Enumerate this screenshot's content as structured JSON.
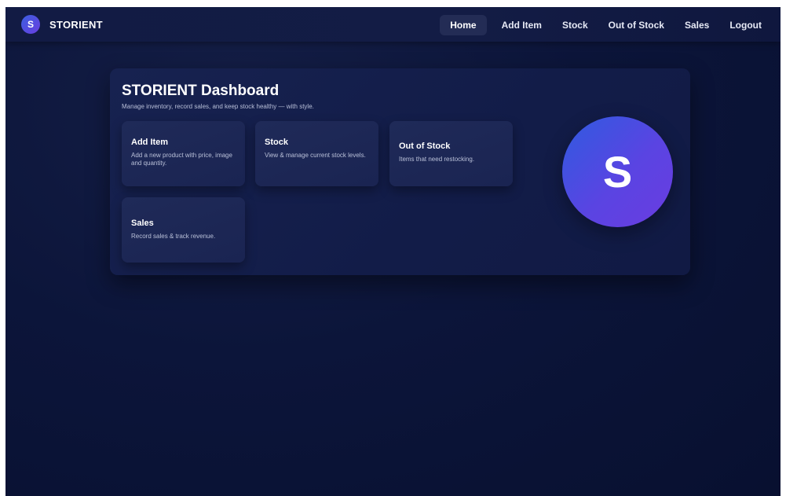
{
  "brand": {
    "logo_letter": "S",
    "name": "STORIENT"
  },
  "nav": {
    "items": [
      {
        "label": "Home",
        "active": true
      },
      {
        "label": "Add Item",
        "active": false
      },
      {
        "label": "Stock",
        "active": false
      },
      {
        "label": "Out of Stock",
        "active": false
      },
      {
        "label": "Sales",
        "active": false
      },
      {
        "label": "Logout",
        "active": false
      }
    ]
  },
  "dashboard": {
    "title": "STORIENT Dashboard",
    "subtitle": "Manage inventory, record sales, and keep stock healthy — with style.",
    "cards": [
      {
        "title": "Add Item",
        "description": "Add a new product with price, image and quantity."
      },
      {
        "title": "Stock",
        "description": "View & manage current stock levels."
      },
      {
        "title": "Out of Stock",
        "description": "Items that need restocking."
      },
      {
        "title": "Sales",
        "description": "Record sales & track revenue."
      }
    ],
    "avatar_letter": "S"
  },
  "colors": {
    "background": "#0c153a",
    "panel": "#151f4c",
    "card": "#1e2957",
    "accent_start": "#2f5be0",
    "accent_end": "#6a3ce0",
    "active_nav": "#232c55"
  }
}
